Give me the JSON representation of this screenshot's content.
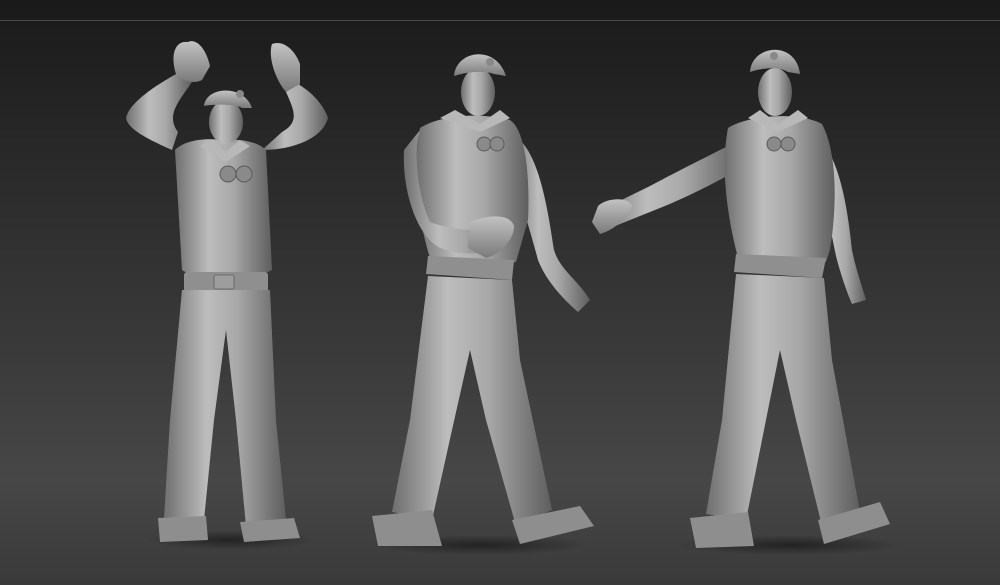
{
  "scene": {
    "background": "#2e2e2e",
    "material_color": "#a9a9a9",
    "figures": [
      {
        "pose": "arms-raised"
      },
      {
        "pose": "walking-hand-forward"
      },
      {
        "pose": "walking-arm-extended"
      }
    ]
  }
}
